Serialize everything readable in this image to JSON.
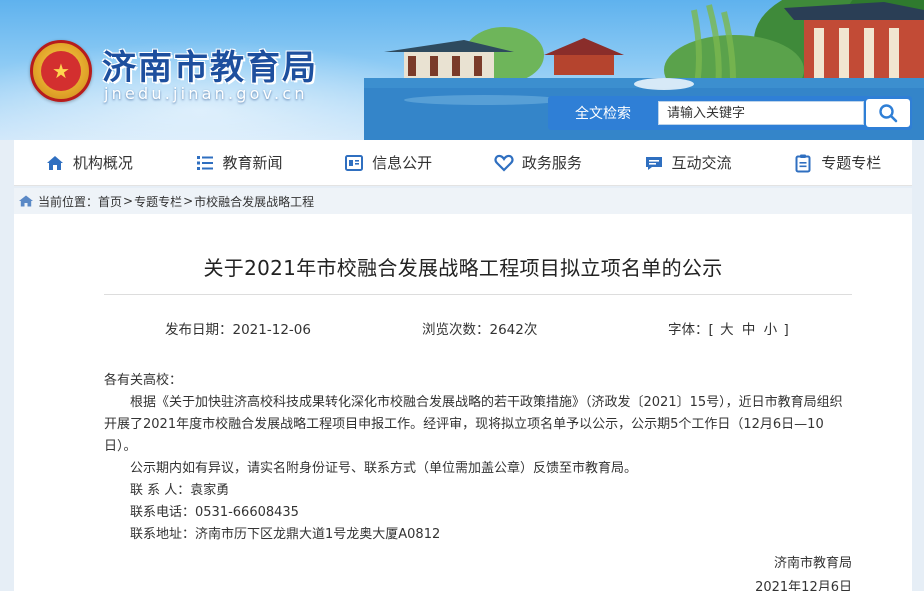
{
  "header": {
    "site_title": "济南市教育局",
    "site_domain": "jnedu.jinan.gov.cn",
    "search_label": "全文检索",
    "search_placeholder": "请输入关键字"
  },
  "nav": {
    "items": [
      {
        "label": "机构概况",
        "icon": "home-icon"
      },
      {
        "label": "教育新闻",
        "icon": "list-icon"
      },
      {
        "label": "信息公开",
        "icon": "document-icon"
      },
      {
        "label": "政务服务",
        "icon": "heart-icon"
      },
      {
        "label": "互动交流",
        "icon": "chat-icon"
      },
      {
        "label": "专题专栏",
        "icon": "clipboard-icon"
      }
    ]
  },
  "breadcrumb": {
    "label": "当前位置：",
    "items": [
      "首页",
      "专题专栏",
      "市校融合发展战略工程"
    ],
    "separator": ">"
  },
  "article": {
    "title": "关于2021年市校融合发展战略工程项目拟立项名单的公示",
    "date_label": "发布日期：2021-12-06",
    "views_label": "浏览次数：2642次",
    "font_label": "字体：[",
    "font_large": "大",
    "font_medium": "中",
    "font_small": "小",
    "font_close": "]",
    "greeting": "各有关高校：",
    "paragraph1": "根据《关于加快驻济高校科技成果转化深化市校融合发展战略的若干政策措施》（济政发〔2021〕15号），近日市教育局组织开展了2021年度市校融合发展战略工程项目申报工作。经评审，现将拟立项名单予以公示，公示期5个工作日（12月6日—10日）。",
    "paragraph2": "公示期内如有异议，请实名附身份证号、联系方式（单位需加盖公章）反馈至市教育局。",
    "contact_person": "联 系 人：袁家勇",
    "contact_phone": "联系电话：0531-66608435",
    "contact_address": "联系地址：济南市历下区龙鼎大道1号龙奥大厦A0812",
    "signature_org": "济南市教育局",
    "signature_date": "2021年12月6日"
  },
  "colors": {
    "brand_blue": "#1d4f9e",
    "nav_icon_blue": "#2f6fc0",
    "search_blue": "#2f7fd6"
  }
}
